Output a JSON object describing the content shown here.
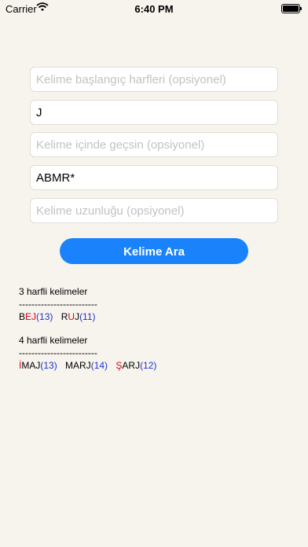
{
  "status_bar": {
    "carrier": "Carrier",
    "time": "6:40 PM"
  },
  "form": {
    "prefix": {
      "placeholder": "Kelime başlangıç harfleri (opsiyonel)",
      "value": ""
    },
    "suffix": {
      "placeholder": "",
      "value": "J"
    },
    "contains": {
      "placeholder": "Kelime içinde geçsin (opsiyonel)",
      "value": ""
    },
    "letters": {
      "placeholder": "",
      "value": "ABMR*"
    },
    "length": {
      "placeholder": "Kelime uzunluğu (opsiyonel)",
      "value": ""
    },
    "search_button_label": "Kelime Ara"
  },
  "results": {
    "groups": [
      {
        "title": "3 harfli kelimeler",
        "separator": "-------------------------",
        "words": [
          {
            "pre": "B",
            "hl": "EJ",
            "post": "",
            "score": "(13)"
          },
          {
            "pre": "R",
            "hl": "U",
            "post": "J",
            "score": "(11)"
          }
        ]
      },
      {
        "title": "4 harfli kelimeler",
        "separator": "-------------------------",
        "words": [
          {
            "pre": "",
            "hl": "İ",
            "post": "MAJ",
            "score": "(13)"
          },
          {
            "pre": "MARJ",
            "hl": "",
            "post": "",
            "score": "(14)"
          },
          {
            "pre": "",
            "hl": "Ş",
            "post": "ARJ",
            "score": "(12)"
          }
        ]
      }
    ]
  },
  "colors": {
    "highlight": "#e0001a",
    "score": "#1e35c9",
    "button": "#1a82fb",
    "background": "#f7f4ee"
  }
}
